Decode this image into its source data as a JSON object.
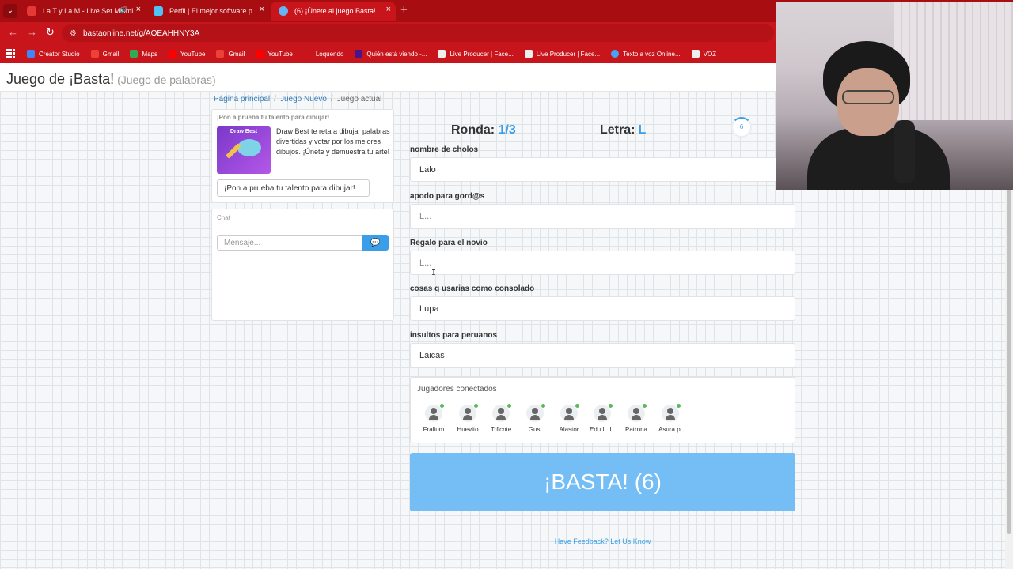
{
  "browser": {
    "tabs": [
      {
        "title": "La T y La M - Live Set Miami",
        "favicon_color": "#e53935"
      },
      {
        "title": "Perfil | El mejor software para p...",
        "favicon_color": "#4fc3f7"
      },
      {
        "title": "(6) ¡Únete al juego Basta!",
        "favicon_color": "#64b5f6"
      }
    ],
    "url": "bastaonline.net/g/AOEAHHNY3A",
    "bookmarks": [
      {
        "label": "Creator Studio",
        "color": "#4285f4"
      },
      {
        "label": "Gmail",
        "color": "#ea4335"
      },
      {
        "label": "Maps",
        "color": "#34a853"
      },
      {
        "label": "YouTube",
        "color": "#ff0000"
      },
      {
        "label": "Gmail",
        "color": "#ea4335"
      },
      {
        "label": "YouTube",
        "color": "#ff0000"
      },
      {
        "label": "Loquendo",
        "color": "#c8151b"
      },
      {
        "label": "Quién está viendo -...",
        "color": "#4a148c"
      },
      {
        "label": "Live Producer | Face...",
        "color": "#eeeeee"
      },
      {
        "label": "Live Producer | Face...",
        "color": "#eeeeee"
      },
      {
        "label": "Texto a voz Online...",
        "color": "#42a5f5"
      },
      {
        "label": "VOZ",
        "color": "#eeeeee"
      }
    ]
  },
  "header": {
    "title": "Juego de ¡Basta!",
    "subtitle": "(Juego de palabras)"
  },
  "breadcrumb": {
    "home": "Página principal",
    "new_game": "Juego Nuevo",
    "current": "Juego actual"
  },
  "promo": {
    "heading": "¡Pon a prueba tu talento para dibujar!",
    "image_title": "Draw Best",
    "text": "Draw Best te reta a dibujar palabras divertidas y votar por los mejores dibujos. ¡Únete y demuestra tu arte!",
    "button": "¡Pon a prueba tu talento para dibujar!"
  },
  "chat": {
    "label": "Chat",
    "placeholder": "Mensaje..."
  },
  "game": {
    "round_label": "Ronda:",
    "round_value": "1/3",
    "letter_label": "Letra:",
    "letter_value": "L",
    "timer": "6",
    "accent_color": "#3a9ee8"
  },
  "fields": [
    {
      "label": "nombre de cholos",
      "value": "Lalo",
      "placeholder": "L..."
    },
    {
      "label": "apodo para gord@s",
      "value": "",
      "placeholder": "L..."
    },
    {
      "label": "Regalo para el novio",
      "value": "",
      "placeholder": "L..."
    },
    {
      "label": "cosas q usarias como consolado",
      "value": "Lupa",
      "placeholder": "L..."
    },
    {
      "label": "insultos para peruanos",
      "value": "Laicas",
      "placeholder": "L..."
    }
  ],
  "players": {
    "title": "Jugadores conectados",
    "list": [
      "Fralium",
      "Huevito",
      "Trficnte",
      "Gusi",
      "Alastor",
      "Edu L. L.",
      "Patrona",
      "Asura p."
    ]
  },
  "basta_button": "¡BASTA! (6)",
  "feedback": "Have Feedback? Let Us Know"
}
